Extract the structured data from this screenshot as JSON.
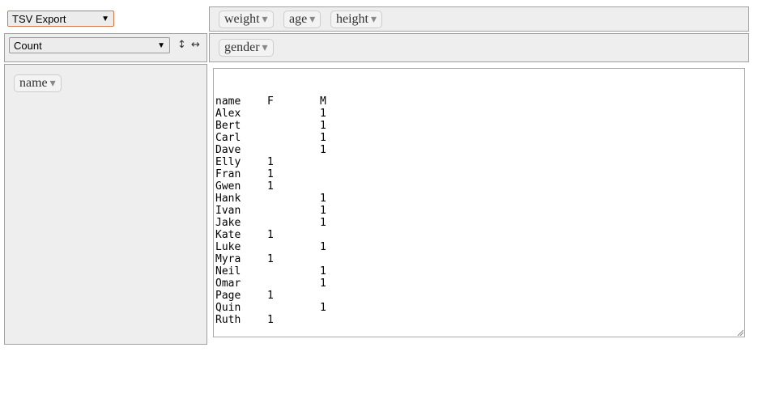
{
  "renderer": {
    "selected": "TSV Export"
  },
  "aggregator": {
    "selected": "Count",
    "row_sort_icon": "↕",
    "col_sort_icon": "↔"
  },
  "unused_attributes": [
    {
      "label": "weight",
      "dropdown_icon": "▾"
    },
    {
      "label": "age",
      "dropdown_icon": "▾"
    },
    {
      "label": "height",
      "dropdown_icon": "▾"
    }
  ],
  "col_attributes": [
    {
      "label": "gender",
      "dropdown_icon": "▾"
    }
  ],
  "row_attributes": [
    {
      "label": "name",
      "dropdown_icon": "▾"
    }
  ],
  "tsv_output": {
    "header": [
      "name",
      "F",
      "M"
    ],
    "rows": [
      [
        "Alex",
        "",
        "1"
      ],
      [
        "Bert",
        "",
        "1"
      ],
      [
        "Carl",
        "",
        "1"
      ],
      [
        "Dave",
        "",
        "1"
      ],
      [
        "Elly",
        "1",
        ""
      ],
      [
        "Fran",
        "1",
        ""
      ],
      [
        "Gwen",
        "1",
        ""
      ],
      [
        "Hank",
        "",
        "1"
      ],
      [
        "Ivan",
        "",
        "1"
      ],
      [
        "Jake",
        "",
        "1"
      ],
      [
        "Kate",
        "1",
        ""
      ],
      [
        "Luke",
        "",
        "1"
      ],
      [
        "Myra",
        "1",
        ""
      ],
      [
        "Neil",
        "",
        "1"
      ],
      [
        "Omar",
        "",
        "1"
      ],
      [
        "Page",
        "1",
        ""
      ],
      [
        "Quin",
        "",
        "1"
      ],
      [
        "Ruth",
        "1",
        ""
      ]
    ]
  }
}
